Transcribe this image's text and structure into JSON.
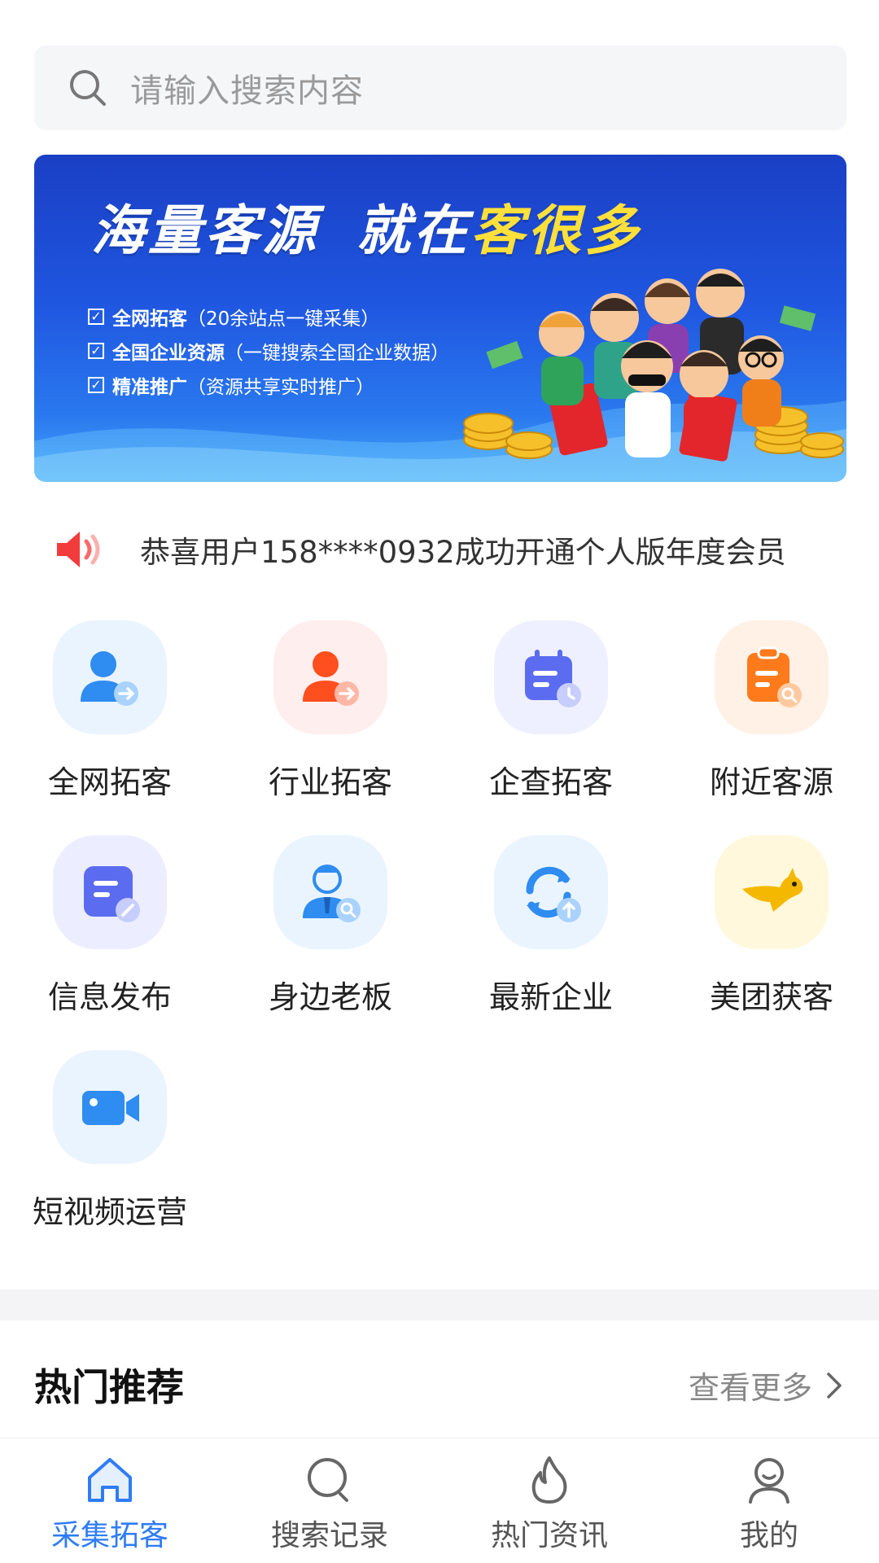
{
  "search": {
    "placeholder": "请输入搜索内容",
    "icon": "search-icon"
  },
  "banner": {
    "headline_part1": "海量客源",
    "headline_part2_white": "就在",
    "headline_part2_yellow": "客很多",
    "features": [
      {
        "bold": "全网拓客",
        "detail": "（20余站点一键采集）"
      },
      {
        "bold": "全国企业资源",
        "detail": "（一键搜索全国企业数据）"
      },
      {
        "bold": "精准推广",
        "detail": "（资源共享实时推广）"
      }
    ],
    "colors": {
      "bg": "#1f56e0",
      "accent": "#ffe03a"
    }
  },
  "notice": {
    "icon": "speaker-icon",
    "text": "恭喜用户158****0932成功开通个人版年度会员"
  },
  "features": [
    {
      "label": "全网拓客",
      "icon": "user-arrow-icon",
      "color": "#2f8cf0"
    },
    {
      "label": "行业拓客",
      "icon": "user-arrow-icon",
      "color": "#ff5a1f"
    },
    {
      "label": "企查拓客",
      "icon": "calendar-clock-icon",
      "color": "#5b6cf0"
    },
    {
      "label": "附近客源",
      "icon": "clipboard-search-icon",
      "color": "#ff7a1a"
    },
    {
      "label": "信息发布",
      "icon": "note-edit-icon",
      "color": "#5b6cf0"
    },
    {
      "label": "身边老板",
      "icon": "businessman-search-icon",
      "color": "#2f8cf0"
    },
    {
      "label": "最新企业",
      "icon": "refresh-upload-icon",
      "color": "#2f8cf0"
    },
    {
      "label": "美团获客",
      "icon": "kangaroo-icon",
      "color": "#f5b800"
    },
    {
      "label": "短视频运营",
      "icon": "video-camera-icon",
      "color": "#2f8cf0"
    }
  ],
  "hot": {
    "title": "热门推荐",
    "more": "查看更多"
  },
  "nav": {
    "tabs": [
      {
        "label": "采集拓客",
        "icon": "home-icon",
        "active": true
      },
      {
        "label": "搜索记录",
        "icon": "search-icon",
        "active": false
      },
      {
        "label": "热门资讯",
        "icon": "fire-icon",
        "active": false
      },
      {
        "label": "我的",
        "icon": "profile-icon",
        "active": false
      }
    ],
    "active_color": "#2f7cf6"
  }
}
